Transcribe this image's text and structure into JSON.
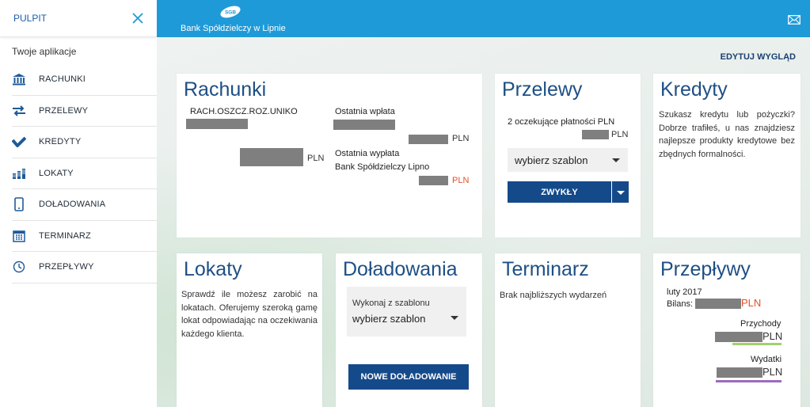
{
  "sidebar": {
    "title": "PULPIT",
    "section": "Twoje aplikacje",
    "items": [
      {
        "label": "RACHUNKI",
        "icon": "bank-icon"
      },
      {
        "label": "PRZELEWY",
        "icon": "transfer-arrows-icon"
      },
      {
        "label": "KREDYTY",
        "icon": "credit-icon"
      },
      {
        "label": "LOKATY",
        "icon": "coins-icon"
      },
      {
        "label": "DOŁADOWANIA",
        "icon": "phone-icon"
      },
      {
        "label": "TERMINARZ",
        "icon": "calendar-icon"
      },
      {
        "label": "PRZEPŁYWY",
        "icon": "clock-icon"
      }
    ]
  },
  "header": {
    "logo_text": "SGB",
    "bank_name": "Bank Spółdzielczy w Lipnie"
  },
  "main": {
    "edit_label": "EDYTUJ WYGLĄD",
    "rachunki": {
      "title": "Rachunki",
      "account_name": "RACH.OSZCZ.ROZ.UNIKO",
      "currency": "PLN",
      "last_in_label": "Ostatnia wpłata",
      "last_in_currency": "PLN",
      "last_out_label": "Ostatnia wypłata",
      "last_out_payee": "Bank Spółdzielczy Lipno",
      "last_out_currency": "PLN"
    },
    "przelewy": {
      "title": "Przelewy",
      "pending": "2 oczekujące płatności PLN",
      "pending_currency": "PLN",
      "template_select": "wybierz szablon",
      "button": "ZWYKŁY"
    },
    "kredyty": {
      "title": "Kredyty",
      "text": "Szukasz kredytu lub pożyczki? Dobrze trafiłeś, u nas znajdziesz najlepsze produkty kredytowe bez zbędnych formalności."
    },
    "lokaty": {
      "title": "Lokaty",
      "text": "Sprawdź ile możesz zarobić na lokatach. Oferujemy szeroką gamę lokat odpowiadając na oczekiwania każdego klienta."
    },
    "doladowania": {
      "title": "Doładowania",
      "template_label": "Wykonaj z szablonu",
      "template_select": "wybierz szablon",
      "button": "NOWE DOŁADOWANIE"
    },
    "terminarz": {
      "title": "Terminarz",
      "text": "Brak najbliższych wydarzeń"
    },
    "przeplywy": {
      "title": "Przepływy",
      "period": "luty 2017",
      "balance_label": "Bilans:",
      "balance_currency": "PLN",
      "income_label": "Przychody",
      "income_currency": "PLN",
      "expense_label": "Wydatki",
      "expense_currency": "PLN"
    }
  },
  "colors": {
    "header_blue": "#1e9ad8",
    "title_blue": "#1e4f85",
    "button_blue": "#154a8a",
    "accent_red": "#e2502a",
    "income_green": "#a5cf6f",
    "expense_purple": "#9b6bbf"
  }
}
